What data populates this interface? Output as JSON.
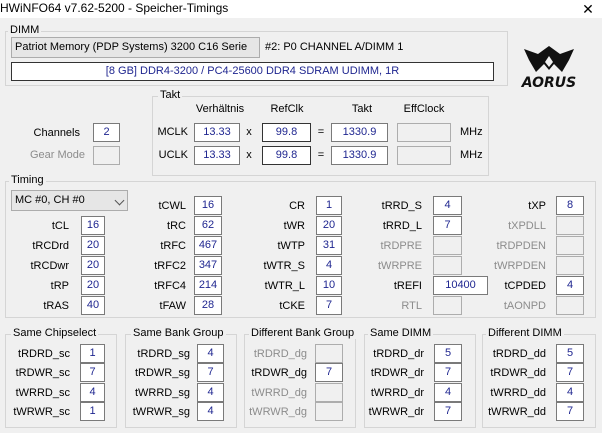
{
  "window": {
    "title": "HWiNFO64 v7.62-5200 - Speicher-Timings",
    "close_glyph": "✕"
  },
  "dimm": {
    "group_label": "DIMM",
    "module_select": "Patriot Memory (PDP Systems) 3200 C16 Serie",
    "slot_label": "#2: P0 CHANNEL A/DIMM 1",
    "description": "[8 GB] DDR4-3200 / PC4-25600 DDR4 SDRAM UDIMM, 1R"
  },
  "logo": {
    "text": "AORUS"
  },
  "takt": {
    "group_label": "Takt",
    "headers": {
      "ratio": "Verhältnis",
      "refclk": "RefClk",
      "clock": "Takt",
      "effclock": "EffClock"
    },
    "mul": "x",
    "eq": "=",
    "unit": "MHz",
    "mclk": {
      "label": "MCLK",
      "ratio": "13.33",
      "refclk": "99.8",
      "clock": "1330.9",
      "effclock": ""
    },
    "uclk": {
      "label": "UCLK",
      "ratio": "13.33",
      "refclk": "99.8",
      "clock": "1330.9",
      "effclock": ""
    }
  },
  "channels": {
    "label": "Channels",
    "value": "2",
    "gear_label": "Gear Mode",
    "gear_value": ""
  },
  "timing": {
    "group_label": "Timing",
    "channel_select": "MC #0, CH #0",
    "items": {
      "tCL": {
        "label": "tCL",
        "value": "16"
      },
      "tRCDrd": {
        "label": "tRCDrd",
        "value": "20"
      },
      "tRCDwr": {
        "label": "tRCDwr",
        "value": "20"
      },
      "tRP": {
        "label": "tRP",
        "value": "20"
      },
      "tRAS": {
        "label": "tRAS",
        "value": "40"
      },
      "tCWL": {
        "label": "tCWL",
        "value": "16"
      },
      "tRC": {
        "label": "tRC",
        "value": "62"
      },
      "tRFC": {
        "label": "tRFC",
        "value": "467"
      },
      "tRFC2": {
        "label": "tRFC2",
        "value": "347"
      },
      "tRFC4": {
        "label": "tRFC4",
        "value": "214"
      },
      "tFAW": {
        "label": "tFAW",
        "value": "28"
      },
      "CR": {
        "label": "CR",
        "value": "1"
      },
      "tWR": {
        "label": "tWR",
        "value": "20"
      },
      "tWTP": {
        "label": "tWTP",
        "value": "31"
      },
      "tWTR_S": {
        "label": "tWTR_S",
        "value": "4"
      },
      "tWTR_L": {
        "label": "tWTR_L",
        "value": "10"
      },
      "tCKE": {
        "label": "tCKE",
        "value": "7"
      },
      "tRRD_S": {
        "label": "tRRD_S",
        "value": "4"
      },
      "tRRD_L": {
        "label": "tRRD_L",
        "value": "7"
      },
      "tRDPRE": {
        "label": "tRDPRE",
        "value": ""
      },
      "tWRPRE": {
        "label": "tWRPRE",
        "value": ""
      },
      "tREFI": {
        "label": "tREFI",
        "value": "10400"
      },
      "RTL": {
        "label": "RTL",
        "value": ""
      },
      "tXP": {
        "label": "tXP",
        "value": "8"
      },
      "tXPDLL": {
        "label": "tXPDLL",
        "value": ""
      },
      "tRDPDEN": {
        "label": "tRDPDEN",
        "value": ""
      },
      "tWRPDEN": {
        "label": "tWRPDEN",
        "value": ""
      },
      "tCPDED": {
        "label": "tCPDED",
        "value": "4"
      },
      "tAONPD": {
        "label": "tAONPD",
        "value": ""
      }
    }
  },
  "turnaround": {
    "same_chipselect": {
      "label": "Same Chipselect",
      "rows": [
        {
          "label": "tRDRD_sc",
          "value": "1"
        },
        {
          "label": "tRDWR_sc",
          "value": "7"
        },
        {
          "label": "tWRRD_sc",
          "value": "4"
        },
        {
          "label": "tWRWR_sc",
          "value": "1"
        }
      ]
    },
    "same_bank_group": {
      "label": "Same Bank Group",
      "rows": [
        {
          "label": "tRDRD_sg",
          "value": "4"
        },
        {
          "label": "tRDWR_sg",
          "value": "7"
        },
        {
          "label": "tWRRD_sg",
          "value": "4"
        },
        {
          "label": "tWRWR_sg",
          "value": "4"
        }
      ]
    },
    "different_bank_group": {
      "label": "Different Bank Group",
      "rows": [
        {
          "label": "tRDRD_dg",
          "value": ""
        },
        {
          "label": "tRDWR_dg",
          "value": "7"
        },
        {
          "label": "tWRRD_dg",
          "value": ""
        },
        {
          "label": "tWRWR_dg",
          "value": ""
        }
      ]
    },
    "same_dimm": {
      "label": "Same DIMM",
      "rows": [
        {
          "label": "tRDRD_dr",
          "value": "5"
        },
        {
          "label": "tRDWR_dr",
          "value": "7"
        },
        {
          "label": "tWRRD_dr",
          "value": "4"
        },
        {
          "label": "tWRWR_dr",
          "value": "7"
        }
      ]
    },
    "different_dimm": {
      "label": "Different DIMM",
      "rows": [
        {
          "label": "tRDRD_dd",
          "value": "5"
        },
        {
          "label": "tRDWR_dd",
          "value": "7"
        },
        {
          "label": "tWRRD_dd",
          "value": "4"
        },
        {
          "label": "tWRWR_dd",
          "value": "7"
        }
      ]
    }
  }
}
